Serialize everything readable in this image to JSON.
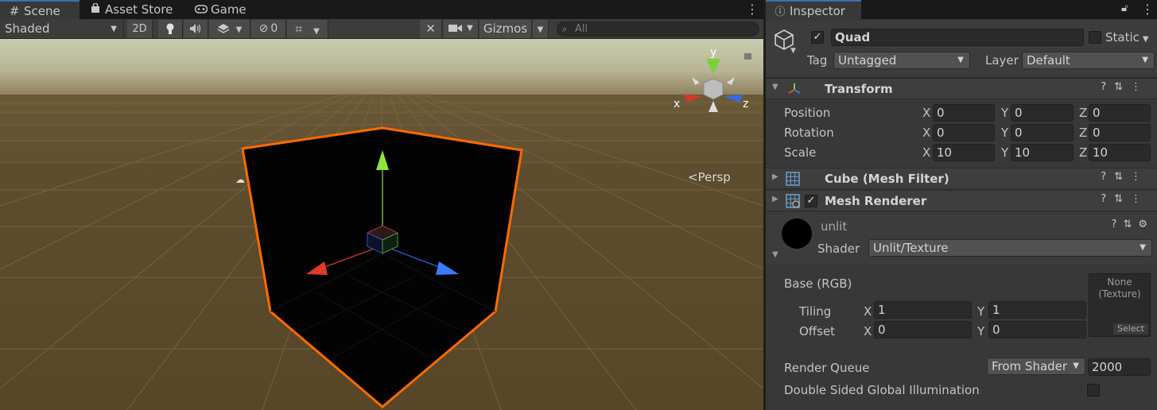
{
  "scene_tabs": {
    "scene": "Scene",
    "asset_store": "Asset Store",
    "game": "Game"
  },
  "toolbar": {
    "shading": "Shaded",
    "mode_2d": "2D",
    "hidden_count": "0",
    "gizmos": "Gizmos",
    "search_placeholder": "All"
  },
  "gizmo": {
    "y": "y",
    "x": "x",
    "z": "z",
    "projection": "Persp"
  },
  "inspector": {
    "tab": "Inspector",
    "object_name": "Quad",
    "static_label": "Static",
    "tag_label": "Tag",
    "tag_value": "Untagged",
    "layer_label": "Layer",
    "layer_value": "Default"
  },
  "transform": {
    "title": "Transform",
    "rows": [
      {
        "label": "Position",
        "x": "0",
        "y": "0",
        "z": "0"
      },
      {
        "label": "Rotation",
        "x": "0",
        "y": "0",
        "z": "0"
      },
      {
        "label": "Scale",
        "x": "10",
        "y": "10",
        "z": "10"
      }
    ],
    "axis_x": "X",
    "axis_y": "Y",
    "axis_z": "Z"
  },
  "mesh_filter": {
    "title": "Cube (Mesh Filter)"
  },
  "mesh_renderer": {
    "title": "Mesh Renderer"
  },
  "material": {
    "name": "unlit",
    "shader_label": "Shader",
    "shader_value": "Unlit/Texture",
    "base_label": "Base (RGB)",
    "tiling_label": "Tiling",
    "tiling_x": "1",
    "tiling_y": "1",
    "offset_label": "Offset",
    "offset_x": "0",
    "offset_y": "0",
    "texture_none": "None (Texture)",
    "texture_select": "Select",
    "render_queue_label": "Render Queue",
    "render_queue_mode": "From Shader",
    "render_queue_value": "2000",
    "double_sided_label": "Double Sided Global Illumination"
  },
  "colors": {
    "selection_outline": "#ff6a00",
    "ground": "#5b4a2c",
    "sky_top": "#cbd6b4"
  }
}
